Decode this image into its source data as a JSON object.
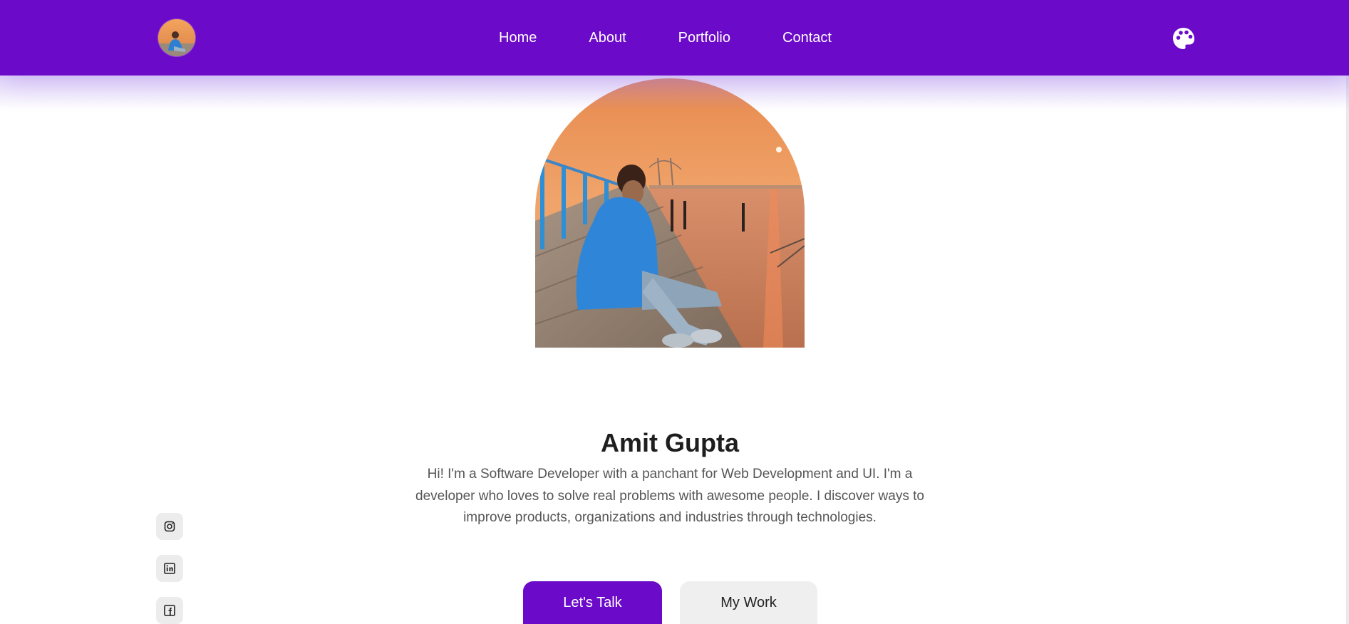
{
  "header": {
    "nav": [
      "Home",
      "About",
      "Portfolio",
      "Contact"
    ],
    "theme_icon": "palette-icon",
    "logo": "profile-avatar"
  },
  "hero": {
    "name": "Amit Gupta",
    "bio": "Hi! I'm a Software Developer with a panchant for Web Development and UI. I'm a developer who loves to solve real problems with awesome people. I discover ways to improve products, organizations and industries through technologies.",
    "primary_button": "Let's Talk",
    "secondary_button": "My Work",
    "photo": "profile-photo"
  },
  "social": [
    "instagram-icon",
    "linkedin-icon",
    "facebook-icon"
  ],
  "colors": {
    "accent": "#6b0ac9",
    "button_secondary": "#efefef",
    "text_dark": "#1e1e1e",
    "text_muted": "#555555"
  }
}
